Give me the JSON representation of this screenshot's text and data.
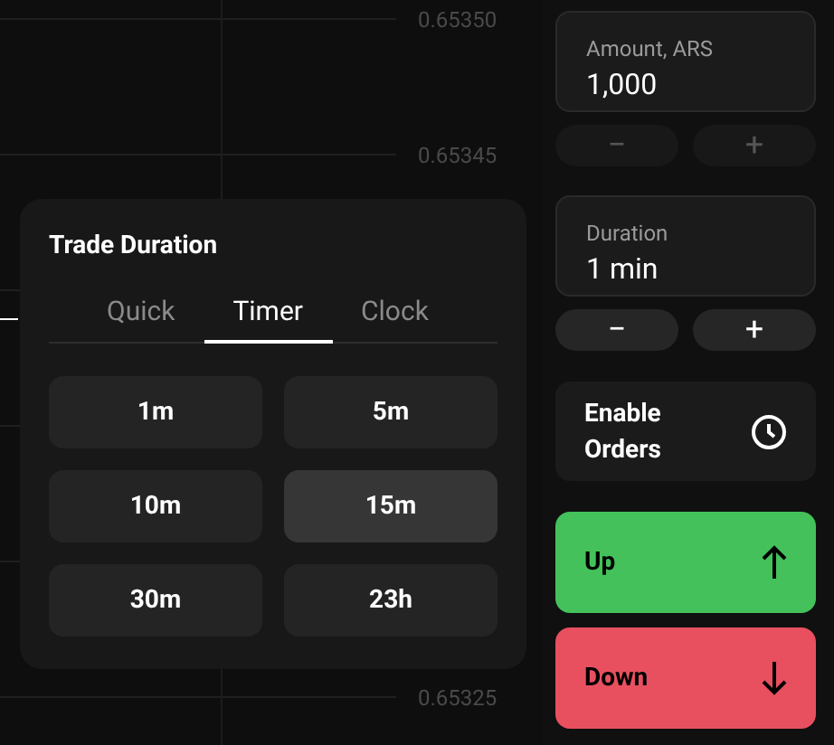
{
  "chart": {
    "price_labels": [
      "0.65350",
      "0.65345",
      "0.65325"
    ]
  },
  "duration_popup": {
    "title": "Trade Duration",
    "tabs": [
      {
        "label": "Quick",
        "selected": false
      },
      {
        "label": "Timer",
        "selected": true
      },
      {
        "label": "Clock",
        "selected": false
      }
    ],
    "options": [
      {
        "label": "1m",
        "selected": false
      },
      {
        "label": "5m",
        "selected": false
      },
      {
        "label": "10m",
        "selected": false
      },
      {
        "label": "15m",
        "selected": true
      },
      {
        "label": "30m",
        "selected": false
      },
      {
        "label": "23h",
        "selected": false
      }
    ]
  },
  "amount": {
    "label": "Amount, ARS",
    "value": "1,000",
    "minus": "−",
    "plus": "+",
    "disabled": true
  },
  "duration": {
    "label": "Duration",
    "value": "1 min",
    "minus": "−",
    "plus": "+",
    "disabled": false
  },
  "enable_orders": {
    "label": "Enable Orders"
  },
  "actions": [
    {
      "kind": "up",
      "label": "Up",
      "color": "#44c15a"
    },
    {
      "kind": "down",
      "label": "Down",
      "color": "#e8505f"
    }
  ]
}
